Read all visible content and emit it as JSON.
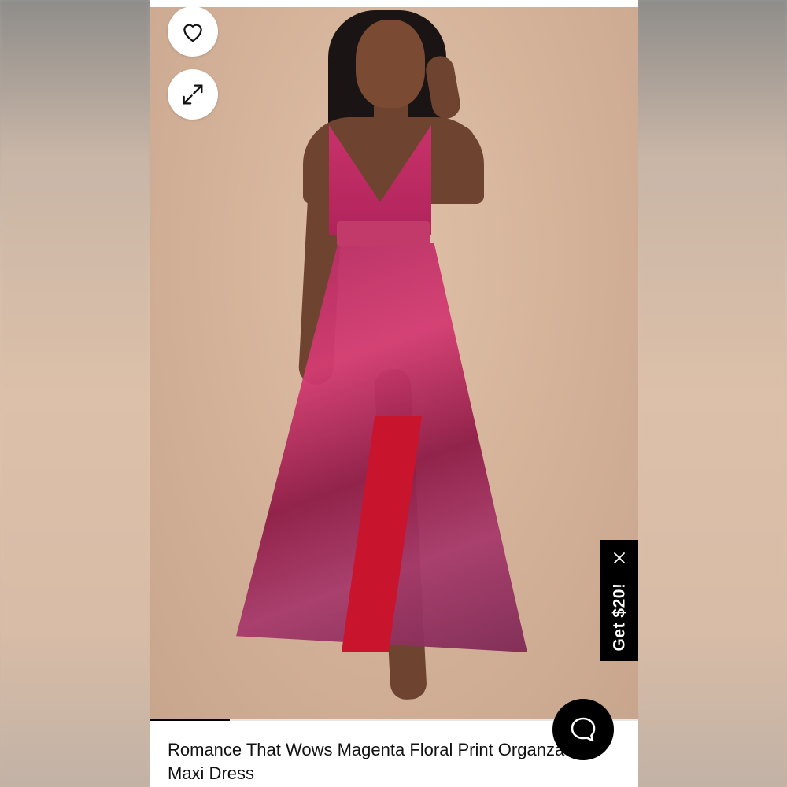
{
  "product": {
    "title": "Romance That Wows Magenta Floral Print Organza Maxi Dress",
    "image_alt": "product-photo"
  },
  "actions": {
    "favorite_icon": "heart-icon",
    "expand_icon": "expand-icon"
  },
  "promo": {
    "label": "Get $20!",
    "close_icon": "close-icon"
  },
  "gallery": {
    "progress_fraction": 0.165
  },
  "chat": {
    "icon": "chat-icon"
  },
  "colors": {
    "accent": "#000000",
    "background": "#ffffff"
  }
}
